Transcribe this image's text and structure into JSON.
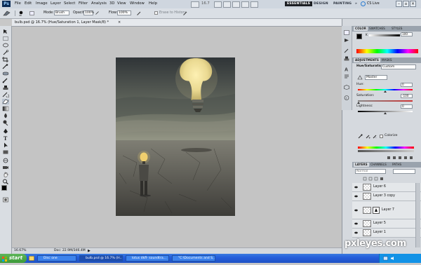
{
  "app": {
    "logo": "Ps",
    "menus": [
      "File",
      "Edit",
      "Image",
      "Layer",
      "Select",
      "Filter",
      "Analysis",
      "3D",
      "View",
      "Window",
      "Help"
    ],
    "zoom_label": "16.7",
    "workspaces": [
      "ESSENTIALS",
      "DESIGN",
      "PAINTING"
    ],
    "workspaces_more": "»",
    "cs_live": "CS Live"
  },
  "options": {
    "mode_label": "Mode:",
    "mode_value": "Brush",
    "opacity_label": "Opacity:",
    "opacity_value": "100%",
    "flow_label": "Flow:",
    "flow_value": "100%",
    "erase_history_label": "Erase to History"
  },
  "document": {
    "tab_title": "bulb.psd @ 16.7% (Hue/Saturation 1, Layer Mask/8) *",
    "zoom": "16.67%",
    "doc_size": "Doc: 22.9M/346.4M"
  },
  "color_panel": {
    "tabs": [
      "COLOR",
      "SWATCHES",
      "STYLES"
    ],
    "value": "100"
  },
  "adjustments_panel": {
    "tabs": [
      "ADJUSTMENTS",
      "MASKS"
    ],
    "title": "Hue/Saturation",
    "preset": "Custom",
    "channel": "Master",
    "hue_label": "Hue:",
    "hue_value": "0",
    "saturation_label": "Saturation:",
    "saturation_value": "-100",
    "lightness_label": "Lightness:",
    "lightness_value": "0",
    "colorize_label": "Colorize"
  },
  "layers_panel": {
    "tabs": [
      "LAYERS",
      "CHANNELS",
      "PATHS"
    ],
    "blend_mode": "Normal",
    "layers": [
      {
        "name": "Layer 6",
        "selected": false
      },
      {
        "name": "Layer 3 copy",
        "selected": false
      },
      {
        "name": "Layer 7",
        "selected": false
      },
      {
        "name": "Layer 5",
        "selected": false
      },
      {
        "name": "Layer 1",
        "selected": false
      }
    ]
  },
  "taskbar": {
    "start": "start",
    "tasks": [
      {
        "label": "Disc one",
        "active": false
      },
      {
        "label": "bulb.psd @ 16.7% (H...",
        "active": true
      },
      {
        "label": "lotus dkfl- soundtra...",
        "active": false
      },
      {
        "label": "\"C:\\Documents and S...",
        "active": false
      }
    ]
  },
  "watermark": "pxleyes.com",
  "colors": {
    "menubar": "#cfd6df",
    "panel_bg": "#d5d9de",
    "taskbar_blue": "#245edb",
    "start_green": "#3c9a38"
  }
}
